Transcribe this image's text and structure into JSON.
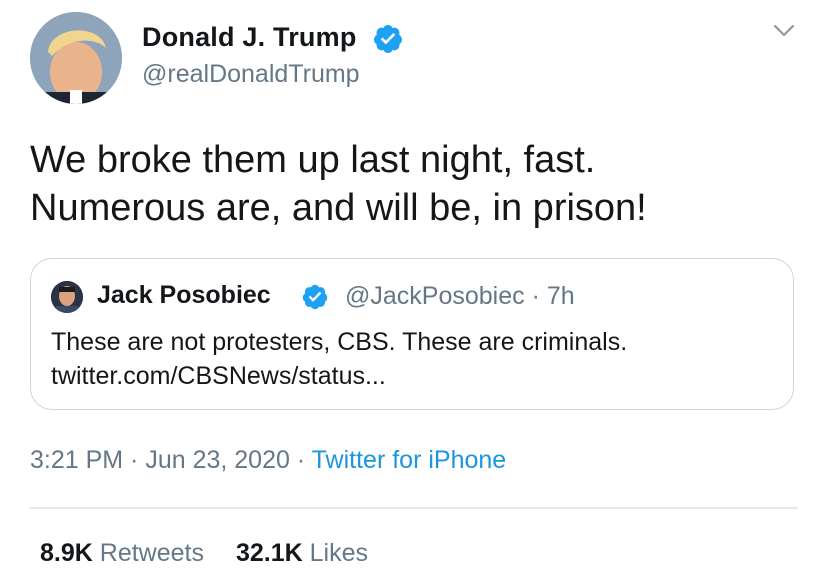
{
  "tweet": {
    "author": {
      "name": "Donald J. Trump",
      "handle": "@realDonaldTrump",
      "verified": true
    },
    "text_lines": [
      "We broke them up last night, fast.",
      "Numerous are, and will be, in prison!"
    ],
    "quoted": {
      "name": "Jack Posobiec",
      "handle_time": "@JackPosobiec · 7h",
      "verified": true,
      "text_lines": [
        "These are not protesters, CBS. These are criminals.",
        "twitter.com/CBSNews/status..."
      ]
    },
    "timestamp": "3:21 PM · Jun 23, 2020",
    "separator": " · ",
    "source": "Twitter for iPhone",
    "stats": {
      "retweets_count": "8.9K",
      "retweets_label": "Retweets",
      "likes_count": "32.1K",
      "likes_label": "Likes"
    }
  },
  "colors": {
    "verified": "#1da1f2",
    "link": "#1b95e0",
    "secondary_text": "#657786",
    "border": "#ccd6dd"
  },
  "icons": {
    "verified": "verified-badge-icon",
    "more": "chevron-down-icon"
  }
}
